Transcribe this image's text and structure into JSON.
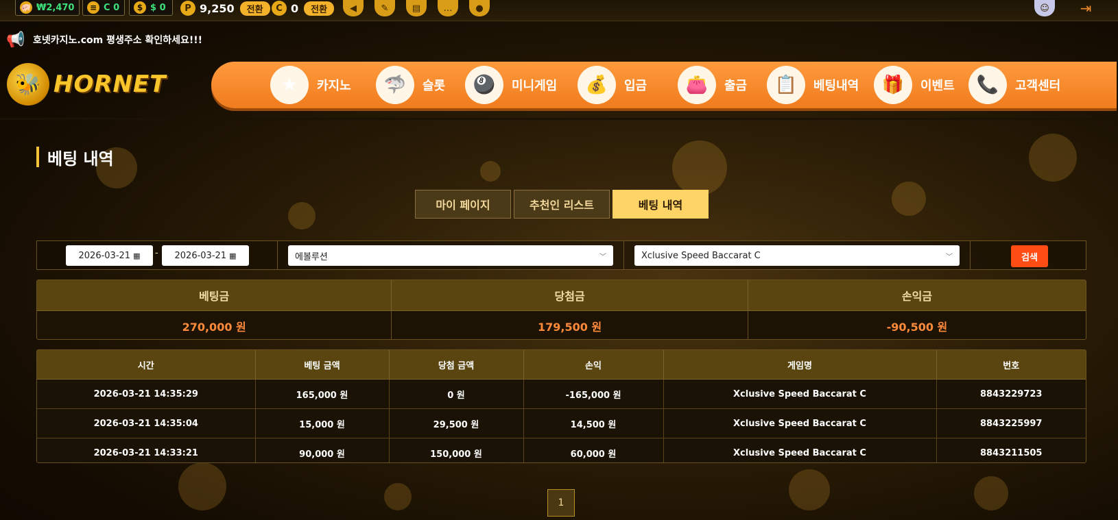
{
  "topbar": {
    "wallets": [
      {
        "icon": "piggy-bank-icon",
        "value": "₩2,470"
      },
      {
        "icon": "coins-icon",
        "value": "C 0"
      },
      {
        "icon": "dollar-icon",
        "value": "$ 0"
      }
    ],
    "points": {
      "badge": "P",
      "value": "9,250",
      "convert": "전환"
    },
    "coupons": {
      "badge": "C",
      "value": "0",
      "convert": "전환"
    }
  },
  "notice": {
    "text": "호넷카지노.com 평생주소 확인하세요!!!"
  },
  "logo": {
    "text": "HORNET"
  },
  "nav": [
    {
      "label": "카지노",
      "icon": "casino-icon"
    },
    {
      "label": "슬롯",
      "icon": "slot-icon"
    },
    {
      "label": "미니게임",
      "icon": "minigame-icon"
    },
    {
      "label": "입금",
      "icon": "deposit-icon"
    },
    {
      "label": "출금",
      "icon": "withdraw-icon"
    },
    {
      "label": "베팅내역",
      "icon": "bet-history-icon"
    },
    {
      "label": "이벤트",
      "icon": "event-icon"
    },
    {
      "label": "고객센터",
      "icon": "support-icon"
    }
  ],
  "page": {
    "title": "베팅 내역"
  },
  "tabs": [
    {
      "label": "마이 페이지",
      "active": false
    },
    {
      "label": "추천인 리스트",
      "active": false
    },
    {
      "label": "베팅 내역",
      "active": true
    }
  ],
  "filter": {
    "date_from": "2026-03-21",
    "date_sep": "-",
    "date_to": "2026-03-21",
    "provider": "에볼루션",
    "game": "Xclusive Speed Baccarat C",
    "search_label": "검색"
  },
  "summary": {
    "headers": [
      "베팅금",
      "당첨금",
      "손익금"
    ],
    "values": [
      "270,000 원",
      "179,500 원",
      "-90,500 원"
    ]
  },
  "records": {
    "headers": [
      "시간",
      "베팅 금액",
      "당첨 금액",
      "손익",
      "게임명",
      "번호"
    ],
    "rows": [
      [
        "2026-03-21 14:35:29",
        "165,000 원",
        "0 원",
        "-165,000 원",
        "Xclusive Speed Baccarat C",
        "8843229723"
      ],
      [
        "2026-03-21 14:35:04",
        "15,000 원",
        "29,500 원",
        "14,500 원",
        "Xclusive Speed Baccarat C",
        "8843225997"
      ],
      [
        "2026-03-21 14:33:21",
        "90,000 원",
        "150,000 원",
        "60,000 원",
        "Xclusive Speed Baccarat C",
        "8843211505"
      ]
    ]
  },
  "pagination": {
    "current": "1"
  }
}
